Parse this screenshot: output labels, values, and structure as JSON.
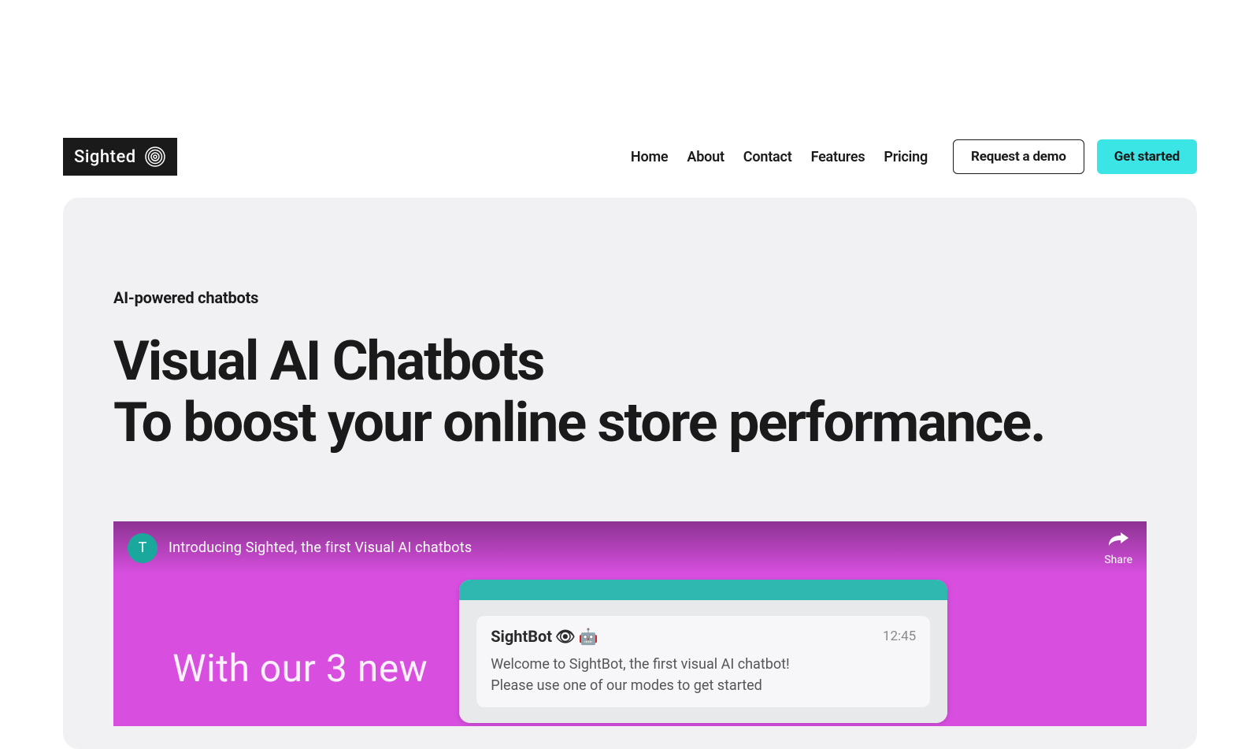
{
  "brand": {
    "name": "Sighted"
  },
  "nav": {
    "links": [
      "Home",
      "About",
      "Contact",
      "Features",
      "Pricing"
    ],
    "demo_button": "Request a demo",
    "cta_button": "Get started"
  },
  "hero": {
    "eyebrow": "AI-powered chatbots",
    "headline_line1": "Visual AI Chatbots",
    "headline_line2": "To boost your online store performance."
  },
  "video": {
    "avatar_letter": "T",
    "title": "Introducing Sighted, the first Visual AI chatbots",
    "share_label": "Share",
    "content_left": "With our 3 new",
    "chat": {
      "bot_name": "SightBot",
      "time": "12:45",
      "message_line1": "Welcome to SightBot, the first visual AI chatbot!",
      "message_line2": "Please use one of our modes to get started"
    }
  }
}
